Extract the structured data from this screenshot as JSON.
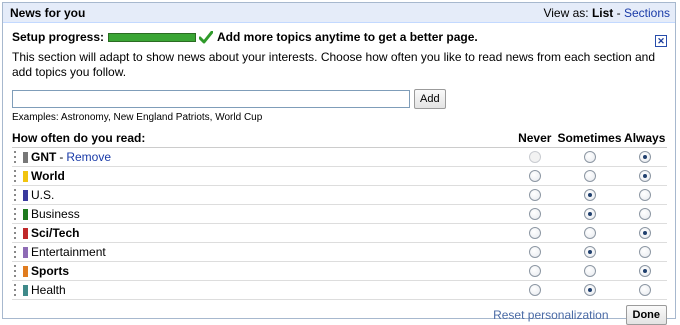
{
  "header": {
    "title": "News for you",
    "view_as_label": "View as:",
    "view_list": "List",
    "view_sep": "-",
    "view_sections": "Sections"
  },
  "setup": {
    "label": "Setup progress:",
    "progress": 1.0,
    "message": "Add more topics anytime to get a better page.",
    "close_icon": "close-icon"
  },
  "description": "This section will adapt to show news about your interests. Choose how often you like to read news from each section and add topics you follow.",
  "add_topic": {
    "value": "",
    "placeholder": "",
    "button_label": "Add",
    "examples": "Examples: Astronomy, New England Patriots, World Cup"
  },
  "table": {
    "question": "How often do you read:",
    "columns": [
      "Never",
      "Sometimes",
      "Always"
    ],
    "rows": [
      {
        "name": "GNT",
        "bold": true,
        "color": "#777777",
        "remove": "Remove",
        "selected": 2,
        "never_disabled": true
      },
      {
        "name": "World",
        "bold": true,
        "color": "#f1c40f",
        "remove": "",
        "selected": 2,
        "never_disabled": false
      },
      {
        "name": "U.S.",
        "bold": false,
        "color": "#3a3a9e",
        "remove": "",
        "selected": 1,
        "never_disabled": false
      },
      {
        "name": "Business",
        "bold": false,
        "color": "#1e7a1e",
        "remove": "",
        "selected": 1,
        "never_disabled": false
      },
      {
        "name": "Sci/Tech",
        "bold": true,
        "color": "#c0282a",
        "remove": "",
        "selected": 2,
        "never_disabled": false
      },
      {
        "name": "Entertainment",
        "bold": false,
        "color": "#8e6bb5",
        "remove": "",
        "selected": 1,
        "never_disabled": false
      },
      {
        "name": "Sports",
        "bold": true,
        "color": "#e07c1f",
        "remove": "",
        "selected": 2,
        "never_disabled": false
      },
      {
        "name": "Health",
        "bold": false,
        "color": "#3f8a8a",
        "remove": "",
        "selected": 1,
        "never_disabled": false
      }
    ]
  },
  "footer": {
    "reset_label": "Reset personalization",
    "done_label": "Done"
  }
}
